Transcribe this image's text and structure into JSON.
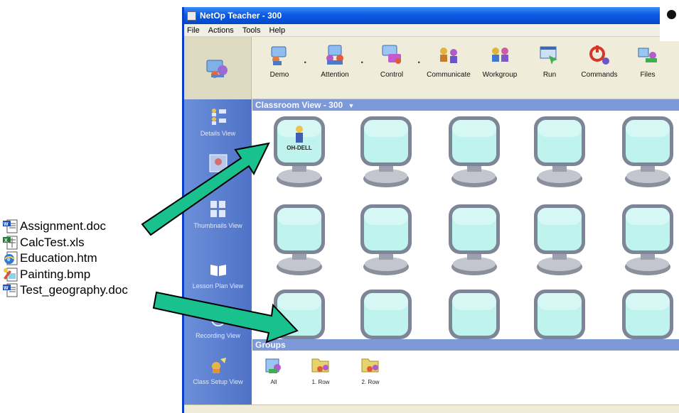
{
  "files": [
    {
      "name": "Assignment.doc",
      "icon": "word-document-icon"
    },
    {
      "name": "CalcTest.xls",
      "icon": "excel-spreadsheet-icon"
    },
    {
      "name": "Education.htm",
      "icon": "html-document-icon"
    },
    {
      "name": "Painting.bmp",
      "icon": "bitmap-image-icon"
    },
    {
      "name": "Test_geography.doc",
      "icon": "word-document-icon"
    }
  ],
  "window": {
    "title": "NetOp Teacher - 300",
    "menu": [
      "File",
      "Actions",
      "Tools",
      "Help"
    ]
  },
  "toolbar": [
    {
      "label": "Demo",
      "icon": "demo-icon"
    },
    {
      "label": "Attention",
      "icon": "attention-icon"
    },
    {
      "label": "Control",
      "icon": "control-icon"
    },
    {
      "label": "Communicate",
      "icon": "communicate-icon"
    },
    {
      "label": "Workgroup",
      "icon": "workgroup-icon"
    },
    {
      "label": "Run",
      "icon": "run-icon"
    },
    {
      "label": "Commands",
      "icon": "commands-icon"
    },
    {
      "label": "Files",
      "icon": "files-icon"
    }
  ],
  "toolbar_separator": ".",
  "leftnav": [
    {
      "label": "Details View"
    },
    {
      "label": "Thumbnails View"
    },
    {
      "label": "Lesson Plan View"
    },
    {
      "label": "Recording View"
    },
    {
      "label": "Class Setup View"
    }
  ],
  "classroom": {
    "header": "Classroom View - 300",
    "computer_label": "OH-DELL"
  },
  "groups": {
    "header": "Groups",
    "items": [
      {
        "label": "All"
      },
      {
        "label": "1. Row"
      },
      {
        "label": "2. Row"
      }
    ]
  },
  "colors": {
    "arrow": "#19c18e",
    "titlebar": "#0b5be3",
    "section_header": "#7d99d8",
    "monitor_screen": "#bff3ee"
  }
}
